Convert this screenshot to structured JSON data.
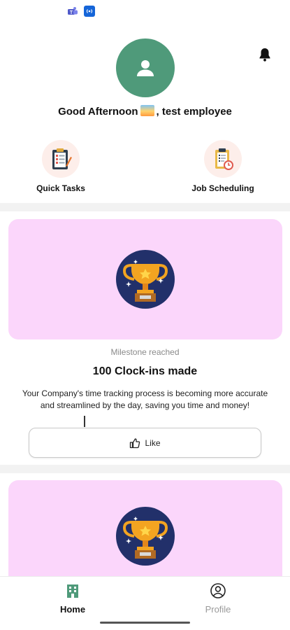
{
  "header": {
    "greeting_prefix": "Good Afternoon",
    "greeting_suffix": ", test employee"
  },
  "quick_actions": [
    {
      "label": "Quick Tasks",
      "icon": "clipboard-checklist-icon"
    },
    {
      "label": "Job Scheduling",
      "icon": "clipboard-clock-icon"
    }
  ],
  "feed": [
    {
      "subtitle": "Milestone reached",
      "title": "100 Clock-ins made",
      "description": "Your Company's time tracking process is becoming more accurate and streamlined by the day, saving you time and money!",
      "like_label": "Like",
      "banner_color": "#fbd6fb"
    }
  ],
  "bottom_nav": {
    "home_label": "Home",
    "profile_label": "Profile"
  },
  "colors": {
    "avatar": "#4f9a7a",
    "home_icon": "#4f9a7a",
    "banner": "#fbd6fb",
    "trophy_bg": "#22306a"
  }
}
